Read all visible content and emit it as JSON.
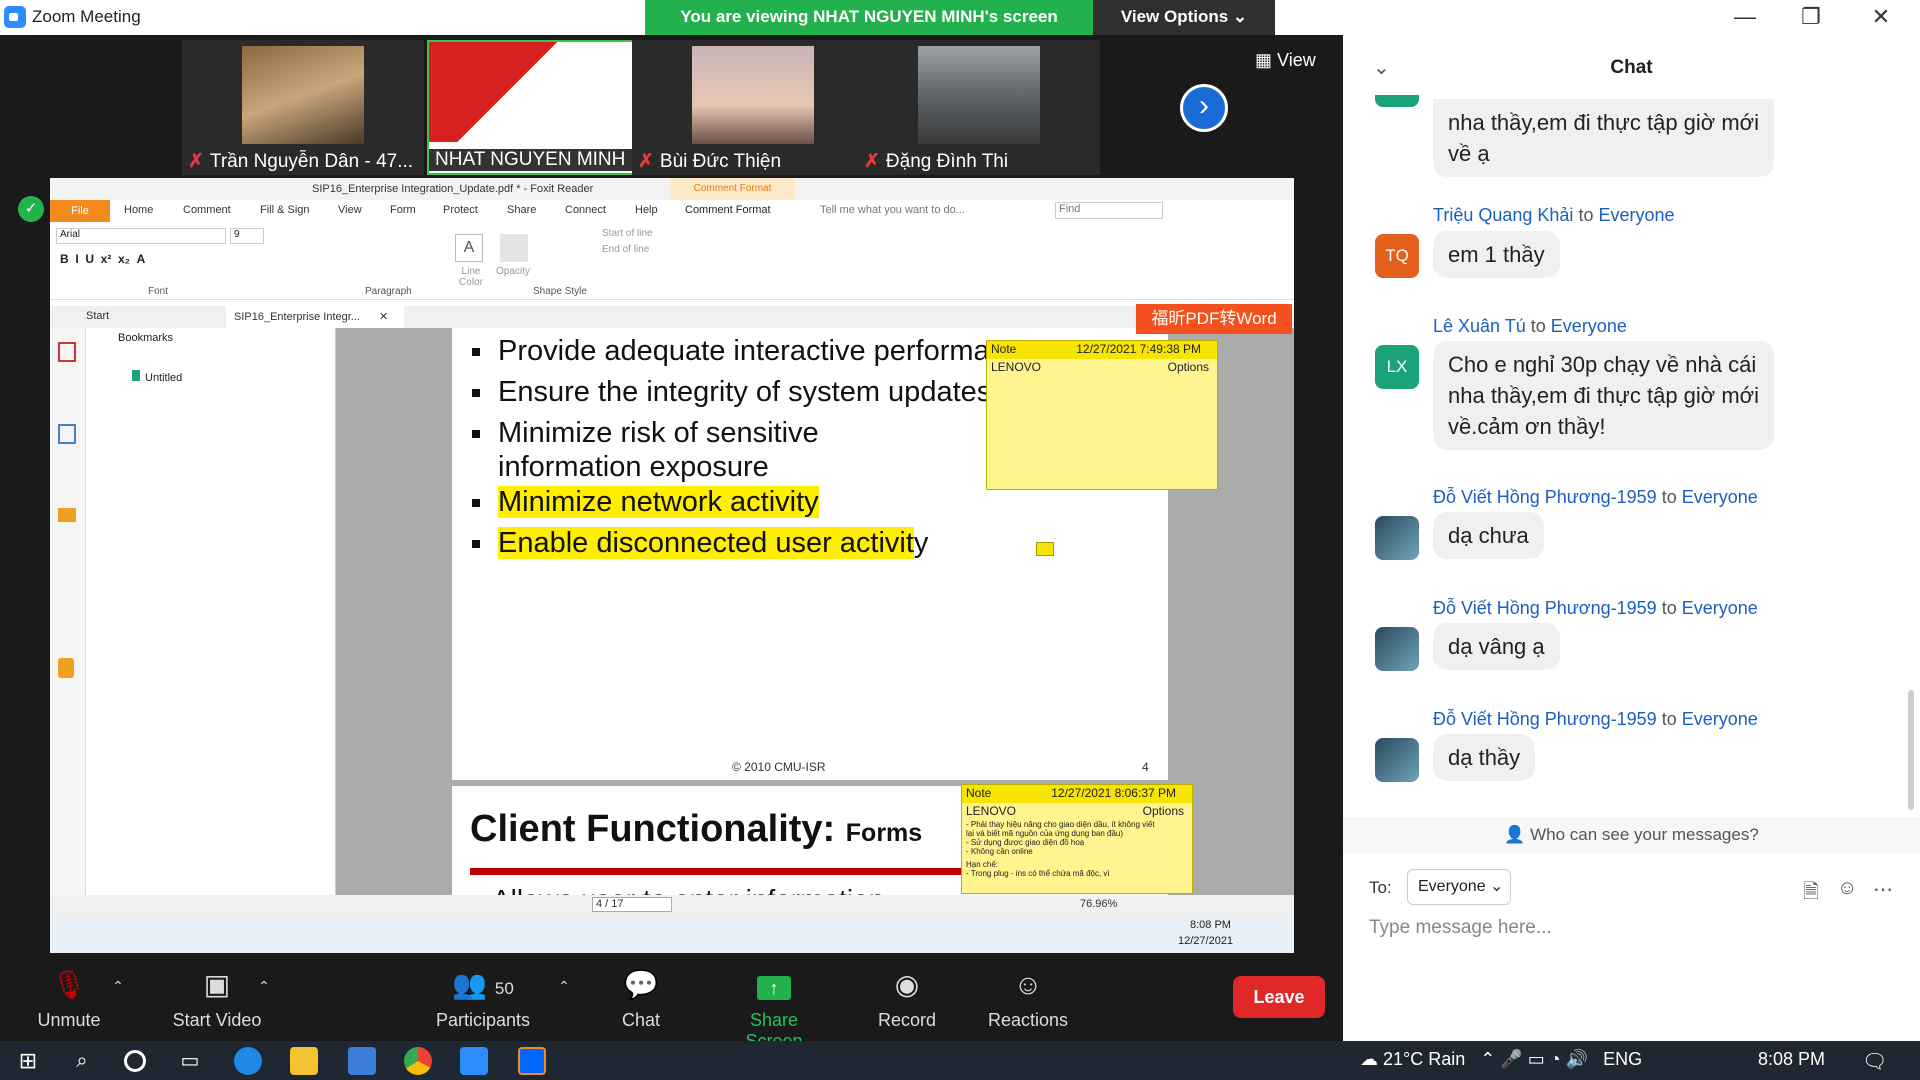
{
  "window": {
    "title": "Zoom Meeting",
    "banner": "You are viewing NHAT NGUYEN MINH's screen",
    "view_options": "View Options",
    "minimize": "—",
    "restore": "❐",
    "close": "✕"
  },
  "participants_strip": [
    {
      "name": "Trần Nguyễn Dân - 47...",
      "muted": true
    },
    {
      "name": "NHAT NGUYEN MINH",
      "muted": false
    },
    {
      "name": "Bùi Đức Thiện",
      "muted": true
    },
    {
      "name": "Đặng Đình Thi",
      "muted": true
    }
  ],
  "view_button": "View",
  "foxit": {
    "title": "SIP16_Enterprise Integration_Update.pdf * - Foxit Reader",
    "comment_format_tab": "Comment Format",
    "menu": [
      "File",
      "Home",
      "Comment",
      "Fill & Sign",
      "View",
      "Form",
      "Protect",
      "Share",
      "Connect",
      "Help",
      "Comment Format"
    ],
    "tell_me": "Tell me what you want to do...",
    "find": "Find",
    "ribbon": {
      "font_name": "Arial",
      "font_size": "9",
      "group_font": "Font",
      "group_paragraph": "Paragraph",
      "line_color": "Line Color",
      "opacity": "Opacity",
      "start_of_line": "Start of line",
      "end_of_line": "End of line",
      "group_shape": "Shape Style"
    },
    "tabs": [
      "Start",
      "SIP16_Enterprise Integr..."
    ],
    "bookmarks_label": "Bookmarks",
    "bookmark_item": "Untitled",
    "pdf2word": "福昕PDF转Word",
    "page1": {
      "bullets": [
        {
          "text": "Provide adequate interactive performance",
          "highlight": false
        },
        {
          "text": "Ensure the integrity of system updates",
          "highlight": false
        },
        {
          "text": "Minimize risk of sensitive information exposure",
          "highlight": false
        },
        {
          "text": "Minimize network activity",
          "highlight": true
        },
        {
          "text": "Enable disconnected user activit",
          "tail": "y",
          "highlight": true
        }
      ],
      "copyright": "© 2010 CMU-ISR",
      "page_number": "4"
    },
    "page2": {
      "title": "Client Functionality:",
      "subtitle": "Forms",
      "next_line": "Allows user to enter information"
    },
    "note1": {
      "type": "Note",
      "time": "12/27/2021 7:49:38 PM",
      "author": "LENOVO",
      "options": "Options"
    },
    "note2": {
      "type": "Note",
      "time": "12/27/2021 8:06:37 PM",
      "author": "LENOVO",
      "options": "Options",
      "lines": [
        "- Phải thay hiệu năng cho giao diện dầu, ít không viết",
        "lại và biết mã nguồn của ứng dụng ban đầu)",
        "- Sử dụng được giao diện đồ hoạ",
        "- Không cần online",
        "Hạn chế:",
        "- Trong plug - ins có thể chứa mã độc, vì"
      ]
    },
    "status": {
      "page": "4 / 17",
      "zoom": "76.96%"
    },
    "taskbar_time": "8:08 PM",
    "taskbar_date": "12/27/2021"
  },
  "toolbar": {
    "unmute": "Unmute",
    "start_video": "Start Video",
    "participants": "Participants",
    "participants_count": "50",
    "chat": "Chat",
    "share_screen": "Share Screen",
    "record": "Record",
    "reactions": "Reactions",
    "leave": "Leave"
  },
  "chat": {
    "title": "Chat",
    "messages": [
      {
        "sender": "",
        "to": "",
        "text_lines": [
          "nha thầy,em đi thực tập giờ mới",
          "về ạ"
        ],
        "avatar": "",
        "avatar_color": "#1aa37a"
      },
      {
        "sender": "Triệu Quang Khải",
        "to": "Everyone",
        "text_lines": [
          "em 1 thầy"
        ],
        "avatar": "TQ",
        "avatar_color": "#e5601d"
      },
      {
        "sender": "Lê Xuân Tú",
        "to": "Everyone",
        "text_lines": [
          "Cho e nghỉ 30p chạy về nhà cái",
          "nha thầy,em đi thực tập giờ mới",
          "về.cảm ơn thầy!"
        ],
        "avatar": "LX",
        "avatar_color": "#1aa37a"
      },
      {
        "sender": "Đỗ Viết Hồng Phương-1959",
        "to": "Everyone",
        "text_lines": [
          "dạ chưa"
        ],
        "avatar": "",
        "avatar_color": "#2b4a5e"
      },
      {
        "sender": "Đỗ Viết Hồng Phương-1959",
        "to": "Everyone",
        "text_lines": [
          "dạ vâng ạ"
        ],
        "avatar": "",
        "avatar_color": "#2b4a5e"
      },
      {
        "sender": "Đỗ Viết Hồng Phương-1959",
        "to": "Everyone",
        "text_lines": [
          "dạ thầy"
        ],
        "avatar": "",
        "avatar_color": "#2b4a5e"
      }
    ],
    "to_word": "to",
    "who_can_see": "Who can see your messages?",
    "to_label": "To:",
    "recipient": "Everyone",
    "placeholder": "Type message here..."
  },
  "taskbar": {
    "weather": "21°C  Rain",
    "language": "ENG",
    "time": "8:08 PM"
  }
}
